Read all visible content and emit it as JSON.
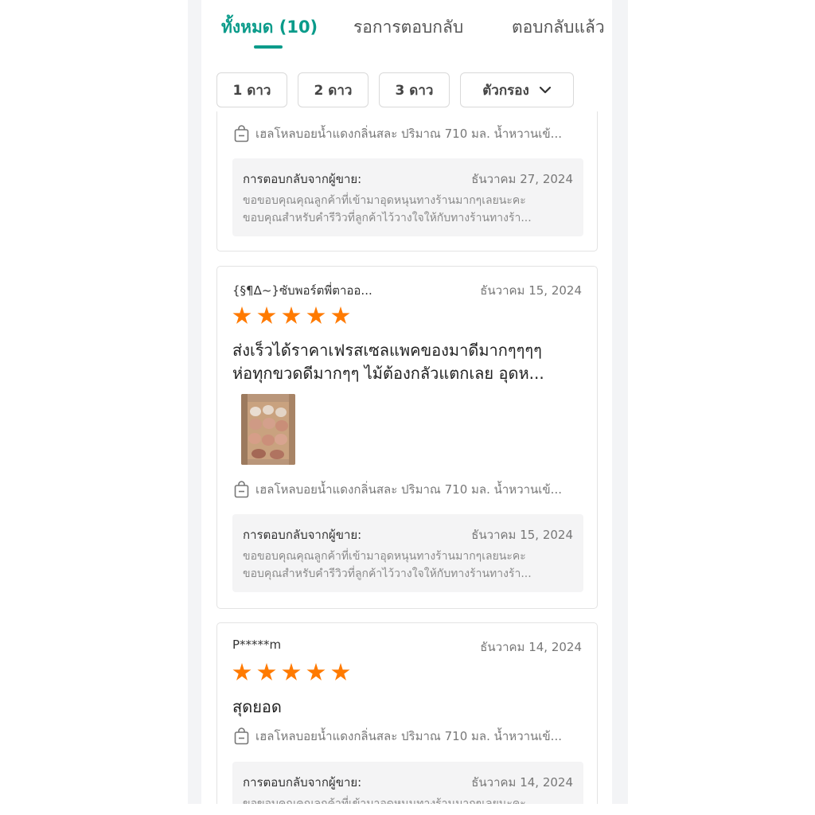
{
  "tabs": {
    "all": "ทั้งหมด (10)",
    "waiting": "รอการตอบกลับ",
    "replied": "ตอบกลับแล้ว"
  },
  "filters": {
    "star1": "1 ดาว",
    "star2": "2 ดาว",
    "star3": "3 ดาว",
    "filter": "ตัวกรอง",
    "filter_icon": "chevron-down-icon"
  },
  "rating_color": "#ff7a00",
  "accent_color": "#0a9b8a",
  "reviews": [
    {
      "product": "เฮลโหลบอยน้ำแดงกลิ่นสละ ปริมาณ 710 มล. น้ำหวานเข้...",
      "reply_label": "การตอบกลับจากผู้ขาย:",
      "reply_date": "ธันวาคม 27, 2024",
      "reply_line1": "ขอขอบคุณคุณลูกค้าที่เข้ามาอุดหนุนทางร้านมากๆเลยนะคะ",
      "reply_line2": "ขอบคุณสำหรับคำรีวิวที่ลูกค้าไว้วางใจให้กับทางร้านทางร้า..."
    },
    {
      "reviewer": "{§¶Δ~}ซับพอร์ตพี่ตาออ...",
      "date": "ธันวาคม 15, 2024",
      "rating": 5,
      "comment_line1": "ส่งเร็วได้ราคาเฟรสเซลแพคของมาดีมากๆๆๆๆ",
      "comment_line2": "ห่อทุกขวดดีมากๆๆ ไม้ต้องกลัวแตกเลย อุดห...",
      "product": "เฮลโหลบอยน้ำแดงกลิ่นสละ ปริมาณ 710 มล. น้ำหวานเข้...",
      "reply_label": "การตอบกลับจากผู้ขาย:",
      "reply_date": "ธันวาคม 15, 2024",
      "reply_line1": "ขอขอบคุณคุณลูกค้าที่เข้ามาอุดหนุนทางร้านมากๆเลยนะคะ",
      "reply_line2": "ขอบคุณสำหรับคำรีวิวที่ลูกค้าไว้วางใจให้กับทางร้านทางร้า..."
    },
    {
      "reviewer": "P*****m",
      "date": "ธันวาคม 14, 2024",
      "rating": 5,
      "comment_line1": "สุดยอด",
      "product": "เฮลโหลบอยน้ำแดงกลิ่นสละ ปริมาณ 710 มล. น้ำหวานเข้...",
      "reply_label": "การตอบกลับจากผู้ขาย:",
      "reply_date": "ธันวาคม 14, 2024",
      "reply_line1": "ขอขอบคุณคุณลูกค้าที่เข้ามาอุดหนุนทางร้านมากๆเลยนะคะ"
    }
  ]
}
